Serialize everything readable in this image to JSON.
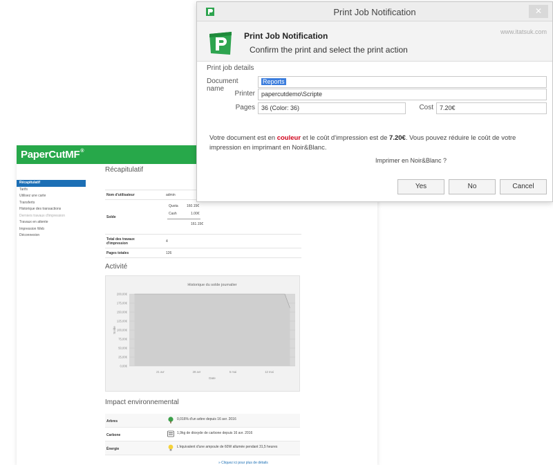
{
  "dialog": {
    "title": "Print Job Notification",
    "close_label": "✕",
    "header_title": "Print Job Notification",
    "header_subtitle": "Confirm the print and select the print action",
    "url": "www.itatsuk.com",
    "group_label": "Print job details",
    "fields": {
      "document_name_label": "Document name",
      "document_name_value": "Reports",
      "printer_label": "Printer",
      "printer_value": "papercutdemo\\Scripte",
      "pages_label": "Pages",
      "pages_value": "36   (Color: 36)",
      "cost_label": "Cost",
      "cost_value": "7.20€"
    },
    "message": {
      "prefix": "Votre document est en ",
      "highlight": "couleur",
      "middle": " et le coût d'impression est de ",
      "amount": "7.20€",
      "suffix": ". Vous pouvez réduire le coût de votre",
      "line2": "impression en imprimant en Noir&Blanc."
    },
    "question": "Imprimer en Noir&Blanc ?",
    "buttons": {
      "yes": "Yes",
      "no": "No",
      "cancel": "Cancel"
    },
    "colors": {
      "accent": "#2ea44f",
      "highlight": "#3b7ddd",
      "warning": "#d0021b"
    }
  },
  "papercut": {
    "logo": "PaperCutMF",
    "logo_mark": "®",
    "brand_color": "#27a84a",
    "nav": [
      {
        "label": "Récapitulatif",
        "active": true
      },
      {
        "label": "Tarifs",
        "active": false
      },
      {
        "label": "Utilisez une carte",
        "active": false
      },
      {
        "label": "Transferts",
        "active": false
      },
      {
        "label": "Historique des transactions",
        "active": false
      },
      {
        "label": "Derniers travaux d'impression",
        "active": false,
        "dim": true
      },
      {
        "label": "Travaux en attente",
        "active": false
      },
      {
        "label": "Impression Web",
        "active": false
      },
      {
        "label": "Déconnexion",
        "active": false
      }
    ],
    "recap": {
      "title": "Récapitulatif",
      "user_label": "Nom d'utilisateur",
      "user_value": "admin",
      "balance_label": "Solde",
      "quota_label": "Quota",
      "quota_value": "160.15€",
      "cash_label": "Cash",
      "cash_value": "1.00€",
      "total_value": "161.15€",
      "docs_label": "Total des travaux d'impression",
      "docs_value": "4",
      "pages_label": "Pages totales",
      "pages_value": "126"
    },
    "activity": {
      "title": "Activité"
    },
    "chart_data": {
      "type": "area",
      "title": "Historique du solde journalier",
      "xlabel": "Date",
      "ylabel": "Solde",
      "x_ticks": [
        "21 avr",
        "28 avr",
        "5 mai",
        "12 mai"
      ],
      "y_ticks": [
        "0,00€",
        "25,00€",
        "50,00€",
        "75,00€",
        "100,00€",
        "125,00€",
        "150,00€",
        "175,00€",
        "200,00€"
      ],
      "ylim": [
        0,
        200
      ],
      "x": [
        "2016-04-16",
        "2016-05-15",
        "2016-05-16"
      ],
      "values": [
        200,
        200,
        161.15
      ],
      "grid": true
    },
    "impact": {
      "title": "Impact environnemental",
      "rows": [
        {
          "label": "Arbres",
          "icon": "tree-icon",
          "value": "0,016% d'un arbre depuis 16 avr. 2016"
        },
        {
          "label": "Carbone",
          "icon": "co2-icon",
          "value": "1,9kg de dioxyde de carbone depuis 16 avr. 2016"
        },
        {
          "label": "Énergie",
          "icon": "bulb-icon",
          "value": "L'équivalent d'une ampoule de 60W allumée pendant 31,5 heures"
        }
      ],
      "link": "» Cliquez ici pour plus de détails"
    }
  }
}
